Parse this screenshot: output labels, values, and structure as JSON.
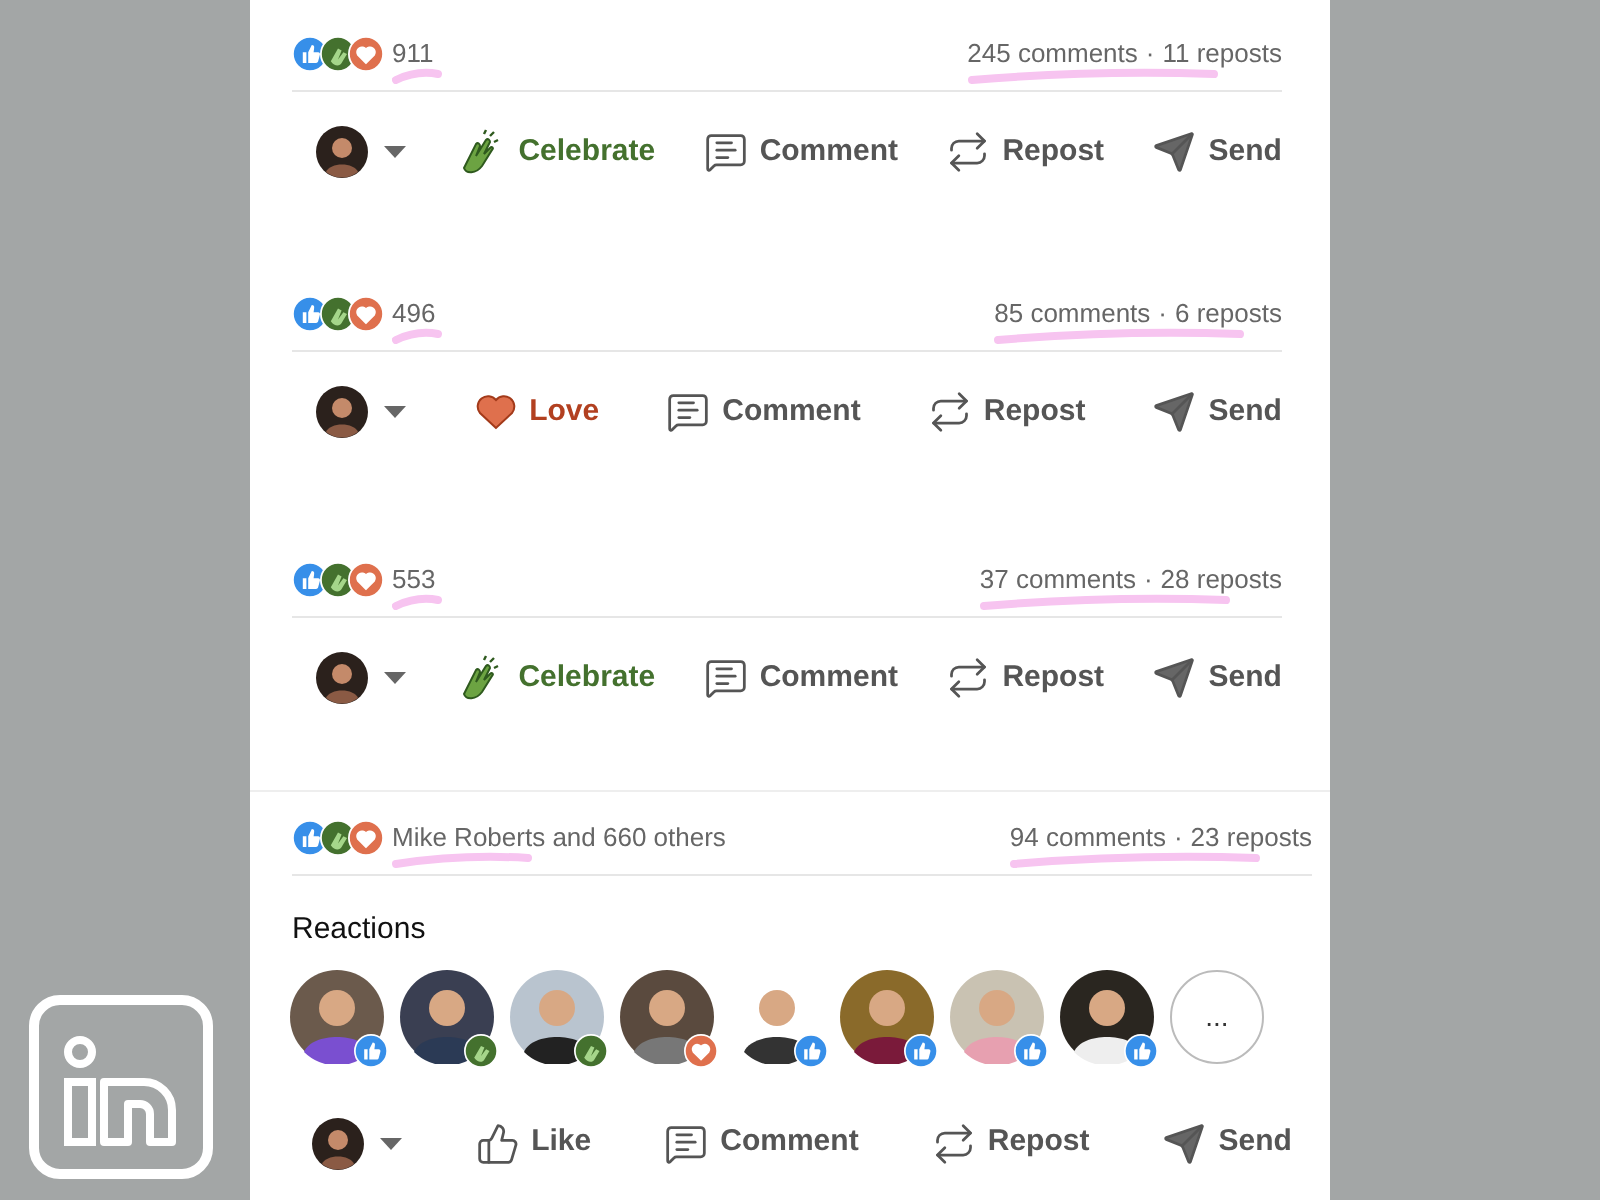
{
  "posts": [
    {
      "reactions_summary": "911",
      "comments": "245 comments",
      "separator": "·",
      "reposts": "11 reposts",
      "my_reaction": {
        "kind": "celebrate",
        "label": "Celebrate"
      },
      "actions": [
        "Comment",
        "Repost",
        "Send"
      ]
    },
    {
      "reactions_summary": "496",
      "comments": "85 comments",
      "separator": "·",
      "reposts": "6 reposts",
      "my_reaction": {
        "kind": "love",
        "label": "Love"
      },
      "actions": [
        "Comment",
        "Repost",
        "Send"
      ]
    },
    {
      "reactions_summary": "553",
      "comments": "37 comments",
      "separator": "·",
      "reposts": "28 reposts",
      "my_reaction": {
        "kind": "celebrate",
        "label": "Celebrate"
      },
      "actions": [
        "Comment",
        "Repost",
        "Send"
      ]
    },
    {
      "reactions_summary": "Mike Roberts and 660 others",
      "comments": "94 comments",
      "separator": "·",
      "reposts": "23 reposts",
      "my_reaction": {
        "kind": "like",
        "label": "Like"
      },
      "actions": [
        "Comment",
        "Repost",
        "Send"
      ],
      "reactions_panel": {
        "heading": "Reactions",
        "people": [
          {
            "kind": "like"
          },
          {
            "kind": "celebrate"
          },
          {
            "kind": "celebrate"
          },
          {
            "kind": "love"
          },
          {
            "kind": "like"
          },
          {
            "kind": "like"
          },
          {
            "kind": "like"
          },
          {
            "kind": "like"
          }
        ],
        "more": "..."
      }
    }
  ]
}
